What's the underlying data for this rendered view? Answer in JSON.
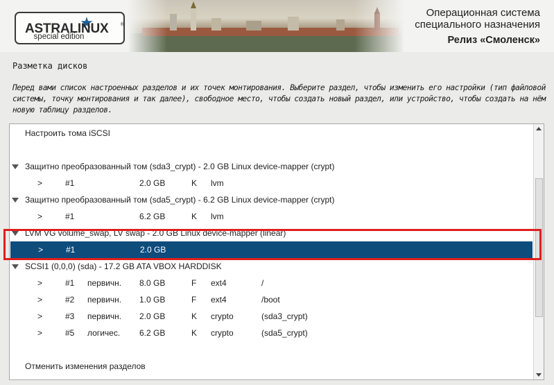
{
  "brand": {
    "logo_text": "ASTRALINUX",
    "logo_mark": "®",
    "logo_sub": "special edition",
    "star_icon": "star-icon",
    "accent_color": "#1f5f99"
  },
  "header": {
    "line1": "Операционная система",
    "line2": "специального назначения",
    "release": "Релиз «Смоленск»"
  },
  "page": {
    "title": "Разметка дисков",
    "intro": "Перед вами список настроенных разделов и их точек монтирования. Выберите раздел, чтобы изменить его настройки (тип файловой системы, точку монтирования и так далее), свободное место, чтобы создать новый раздел, или устройство, чтобы создать на нём новую таблицу разделов."
  },
  "list": {
    "selected_color": "#0e4c7c",
    "highlight_color": "#e01e1e",
    "rows": [
      {
        "kind": "action",
        "label": "Настроить тома iSCSI"
      },
      {
        "kind": "blank"
      },
      {
        "kind": "device",
        "label": "Защитно  преобразованный  том  (sda3_crypt) - 2.0 GB Linux device-mapper (crypt)"
      },
      {
        "kind": "partition",
        "arrow": ">",
        "num": "#1",
        "type": "",
        "size": "2.0 GB",
        "flag": "K",
        "fs": "lvm",
        "mount": ""
      },
      {
        "kind": "device",
        "label": "Защитно  преобразованный  том  (sda5_crypt) - 6.2 GB Linux device-mapper (crypt)"
      },
      {
        "kind": "partition",
        "arrow": ">",
        "num": "#1",
        "type": "",
        "size": "6.2 GB",
        "flag": "K",
        "fs": "lvm",
        "mount": ""
      },
      {
        "kind": "device",
        "label": "LVM VG volume_swap, LV swap - 2.0 GB Linux device-mapper (linear)"
      },
      {
        "kind": "partition",
        "selected": true,
        "arrow": ">",
        "num": "#1",
        "type": "",
        "size": "2.0 GB",
        "flag": "",
        "fs": "",
        "mount": ""
      },
      {
        "kind": "device",
        "label": "SCSI1 (0,0,0) (sda) - 17.2 GB ATA VBOX HARDDISK"
      },
      {
        "kind": "partition",
        "arrow": ">",
        "num": "#1",
        "type": "первичн.",
        "size": "8.0 GB",
        "flag": "F",
        "fs": "ext4",
        "mount": "/"
      },
      {
        "kind": "partition",
        "arrow": ">",
        "num": "#2",
        "type": "первичн.",
        "size": "1.0 GB",
        "flag": "F",
        "fs": "ext4",
        "mount": "/boot"
      },
      {
        "kind": "partition",
        "arrow": ">",
        "num": "#3",
        "type": "первичн.",
        "size": "2.0 GB",
        "flag": "K",
        "fs": "crypto",
        "mount": "(sda3_crypt)"
      },
      {
        "kind": "partition",
        "arrow": ">",
        "num": "#5",
        "type": "логичес.",
        "size": "6.2 GB",
        "flag": "K",
        "fs": "crypto",
        "mount": "(sda5_crypt)"
      },
      {
        "kind": "blank"
      },
      {
        "kind": "action",
        "label": "Отменить изменения разделов"
      }
    ]
  }
}
